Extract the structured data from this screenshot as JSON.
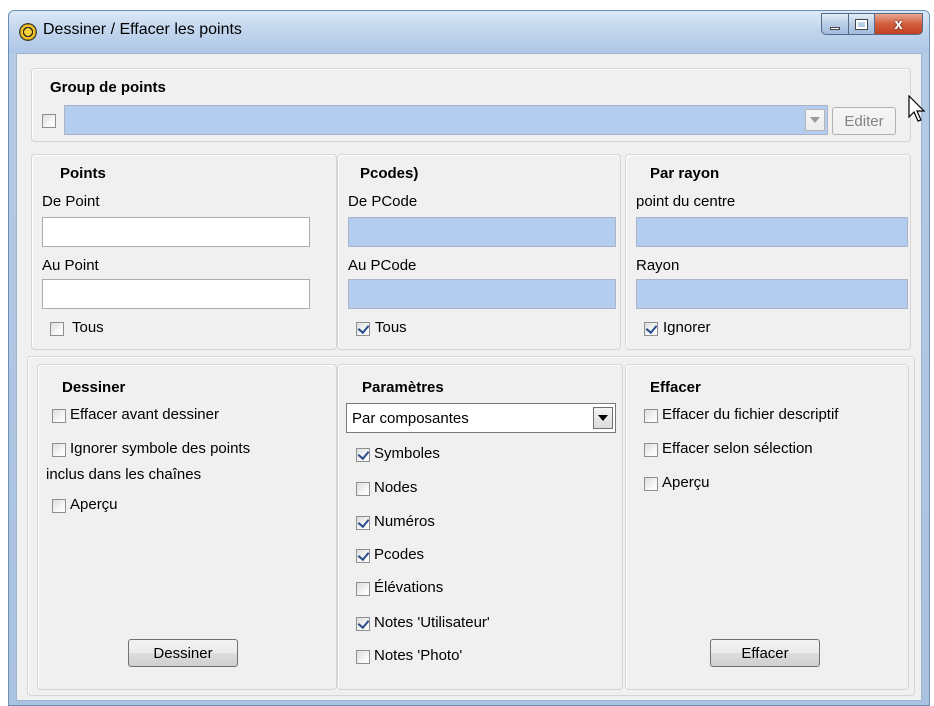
{
  "window": {
    "title": "Dessiner / Effacer les points",
    "minimize": "minimize",
    "maximize": "maximize",
    "close": "x"
  },
  "group": {
    "title": "Group de points",
    "checked": false,
    "value": "",
    "edit_button": "Editer"
  },
  "points": {
    "title": "Points",
    "from_label": "De Point",
    "from_value": "",
    "to_label": "Au Point",
    "to_value": "",
    "all_label": "Tous",
    "all_checked": false
  },
  "pcodes": {
    "title": "Pcodes)",
    "from_label": "De PCode",
    "from_value": "",
    "to_label": "Au PCode",
    "to_value": "",
    "all_label": "Tous",
    "all_checked": true
  },
  "radius": {
    "title": "Par rayon",
    "center_label": "point du centre",
    "center_value": "",
    "radius_label": "Rayon",
    "radius_value": "",
    "ignore_label": "Ignorer",
    "ignore_checked": true
  },
  "draw": {
    "title": "Dessiner",
    "erase_before_label": "Effacer avant dessiner",
    "ignore_symbol_label": "Ignorer symbole des points",
    "ignore_symbol_label2": "inclus dans les chaînes",
    "preview_label": "Aperçu",
    "button": "Dessiner"
  },
  "params": {
    "title": "Paramètres",
    "mode": "Par composantes",
    "options": [
      {
        "label": "Symboles",
        "checked": true
      },
      {
        "label": "Nodes",
        "checked": false
      },
      {
        "label": "Numéros",
        "checked": true
      },
      {
        "label": "Pcodes",
        "checked": true
      },
      {
        "label": "Élévations",
        "checked": false
      },
      {
        "label": "Notes 'Utilisateur'",
        "checked": true
      },
      {
        "label": "Notes 'Photo'",
        "checked": false
      }
    ]
  },
  "erase": {
    "title": "Effacer",
    "descfile_label": "Effacer du fichier descriptif",
    "selection_label": "Effacer selon sélection",
    "preview_label": "Aperçu",
    "button": "Effacer"
  }
}
